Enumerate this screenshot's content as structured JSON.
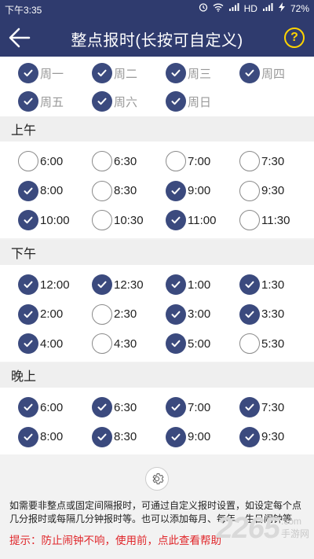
{
  "status_bar": {
    "time": "下午3:35",
    "network": "HD",
    "battery": "72%"
  },
  "app_bar": {
    "title": "整点报时(长按可自定义)",
    "help_label": "?"
  },
  "days": [
    {
      "label": "周一",
      "checked": true
    },
    {
      "label": "周二",
      "checked": true
    },
    {
      "label": "周三",
      "checked": true
    },
    {
      "label": "周四",
      "checked": true
    },
    {
      "label": "周五",
      "checked": true
    },
    {
      "label": "周六",
      "checked": true
    },
    {
      "label": "周日",
      "checked": true
    }
  ],
  "sections": [
    {
      "title": "上午",
      "times": [
        {
          "label": "6:00",
          "checked": false
        },
        {
          "label": "6:30",
          "checked": false
        },
        {
          "label": "7:00",
          "checked": false
        },
        {
          "label": "7:30",
          "checked": false
        },
        {
          "label": "8:00",
          "checked": true
        },
        {
          "label": "8:30",
          "checked": false
        },
        {
          "label": "9:00",
          "checked": true
        },
        {
          "label": "9:30",
          "checked": false
        },
        {
          "label": "10:00",
          "checked": true
        },
        {
          "label": "10:30",
          "checked": false
        },
        {
          "label": "11:00",
          "checked": true
        },
        {
          "label": "11:30",
          "checked": false
        }
      ]
    },
    {
      "title": "下午",
      "times": [
        {
          "label": "12:00",
          "checked": true
        },
        {
          "label": "12:30",
          "checked": true
        },
        {
          "label": "1:00",
          "checked": true
        },
        {
          "label": "1:30",
          "checked": true
        },
        {
          "label": "2:00",
          "checked": true
        },
        {
          "label": "2:30",
          "checked": false
        },
        {
          "label": "3:00",
          "checked": true
        },
        {
          "label": "3:30",
          "checked": true
        },
        {
          "label": "4:00",
          "checked": true
        },
        {
          "label": "4:30",
          "checked": false
        },
        {
          "label": "5:00",
          "checked": true
        },
        {
          "label": "5:30",
          "checked": false
        }
      ]
    },
    {
      "title": "晚上",
      "times": [
        {
          "label": "6:00",
          "checked": true
        },
        {
          "label": "6:30",
          "checked": true
        },
        {
          "label": "7:00",
          "checked": true
        },
        {
          "label": "7:30",
          "checked": true
        },
        {
          "label": "8:00",
          "checked": true
        },
        {
          "label": "8:30",
          "checked": true
        },
        {
          "label": "9:00",
          "checked": true
        },
        {
          "label": "9:30",
          "checked": true
        }
      ]
    }
  ],
  "footer": {
    "info": "如需要非整点或固定间隔报时，可通过自定义报时设置，如设定每个点几分报时或每隔几分钟报时等。也可以添加每月、每年、生日闹钟等",
    "tip": "提示：防止闹钟不响，使用前，点此查看帮助",
    "watermark_number": "2265",
    "watermark_suffix": ".com",
    "watermark_text": "手游网"
  },
  "colors": {
    "primary": "#2f3b6e",
    "checked": "#3b4a7e",
    "tip": "#e0262a",
    "help": "#ffd400"
  }
}
